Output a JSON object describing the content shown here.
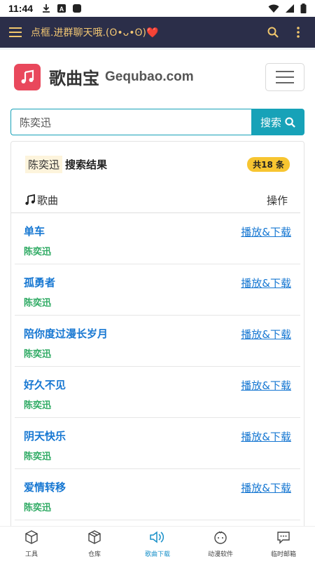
{
  "status_bar": {
    "time": "11:44"
  },
  "app_bar": {
    "title": "点框.进群聊天哦.(ʘ•ᴗ•ʘ)❤️"
  },
  "site": {
    "brand_cn": "歌曲宝",
    "brand_en": "Gequbao.com"
  },
  "search": {
    "value": "陈奕迅",
    "button_label": "搜索"
  },
  "results": {
    "query": "陈奕迅",
    "label": "搜索结果",
    "count": "共18 条",
    "col_song": "歌曲",
    "col_action": "操作",
    "songs": [
      {
        "title": "单车",
        "artist": "陈奕迅",
        "action": "播放&下载"
      },
      {
        "title": "孤勇者",
        "artist": "陈奕迅",
        "action": "播放&下载"
      },
      {
        "title": "陪你度过漫长岁月",
        "artist": "陈奕迅",
        "action": "播放&下载"
      },
      {
        "title": "好久不见",
        "artist": "陈奕迅",
        "action": "播放&下载"
      },
      {
        "title": "阴天快乐",
        "artist": "陈奕迅",
        "action": "播放&下载"
      },
      {
        "title": "爱情转移",
        "artist": "陈奕迅",
        "action": "播放&下载"
      }
    ]
  },
  "bottom_nav": {
    "items": [
      {
        "label": "工具",
        "icon": "cube-icon"
      },
      {
        "label": "仓库",
        "icon": "box-icon"
      },
      {
        "label": "歌曲下载",
        "icon": "speaker-icon",
        "active": true
      },
      {
        "label": "动漫软件",
        "icon": "face-icon"
      },
      {
        "label": "临时邮箱",
        "icon": "message-icon"
      }
    ]
  },
  "colors": {
    "app_bar": "#2b2e49",
    "accent": "#17a2b8",
    "link": "#1677d2",
    "artist": "#2eaa63",
    "badge": "#f7c531",
    "logo": "#e9485c"
  }
}
